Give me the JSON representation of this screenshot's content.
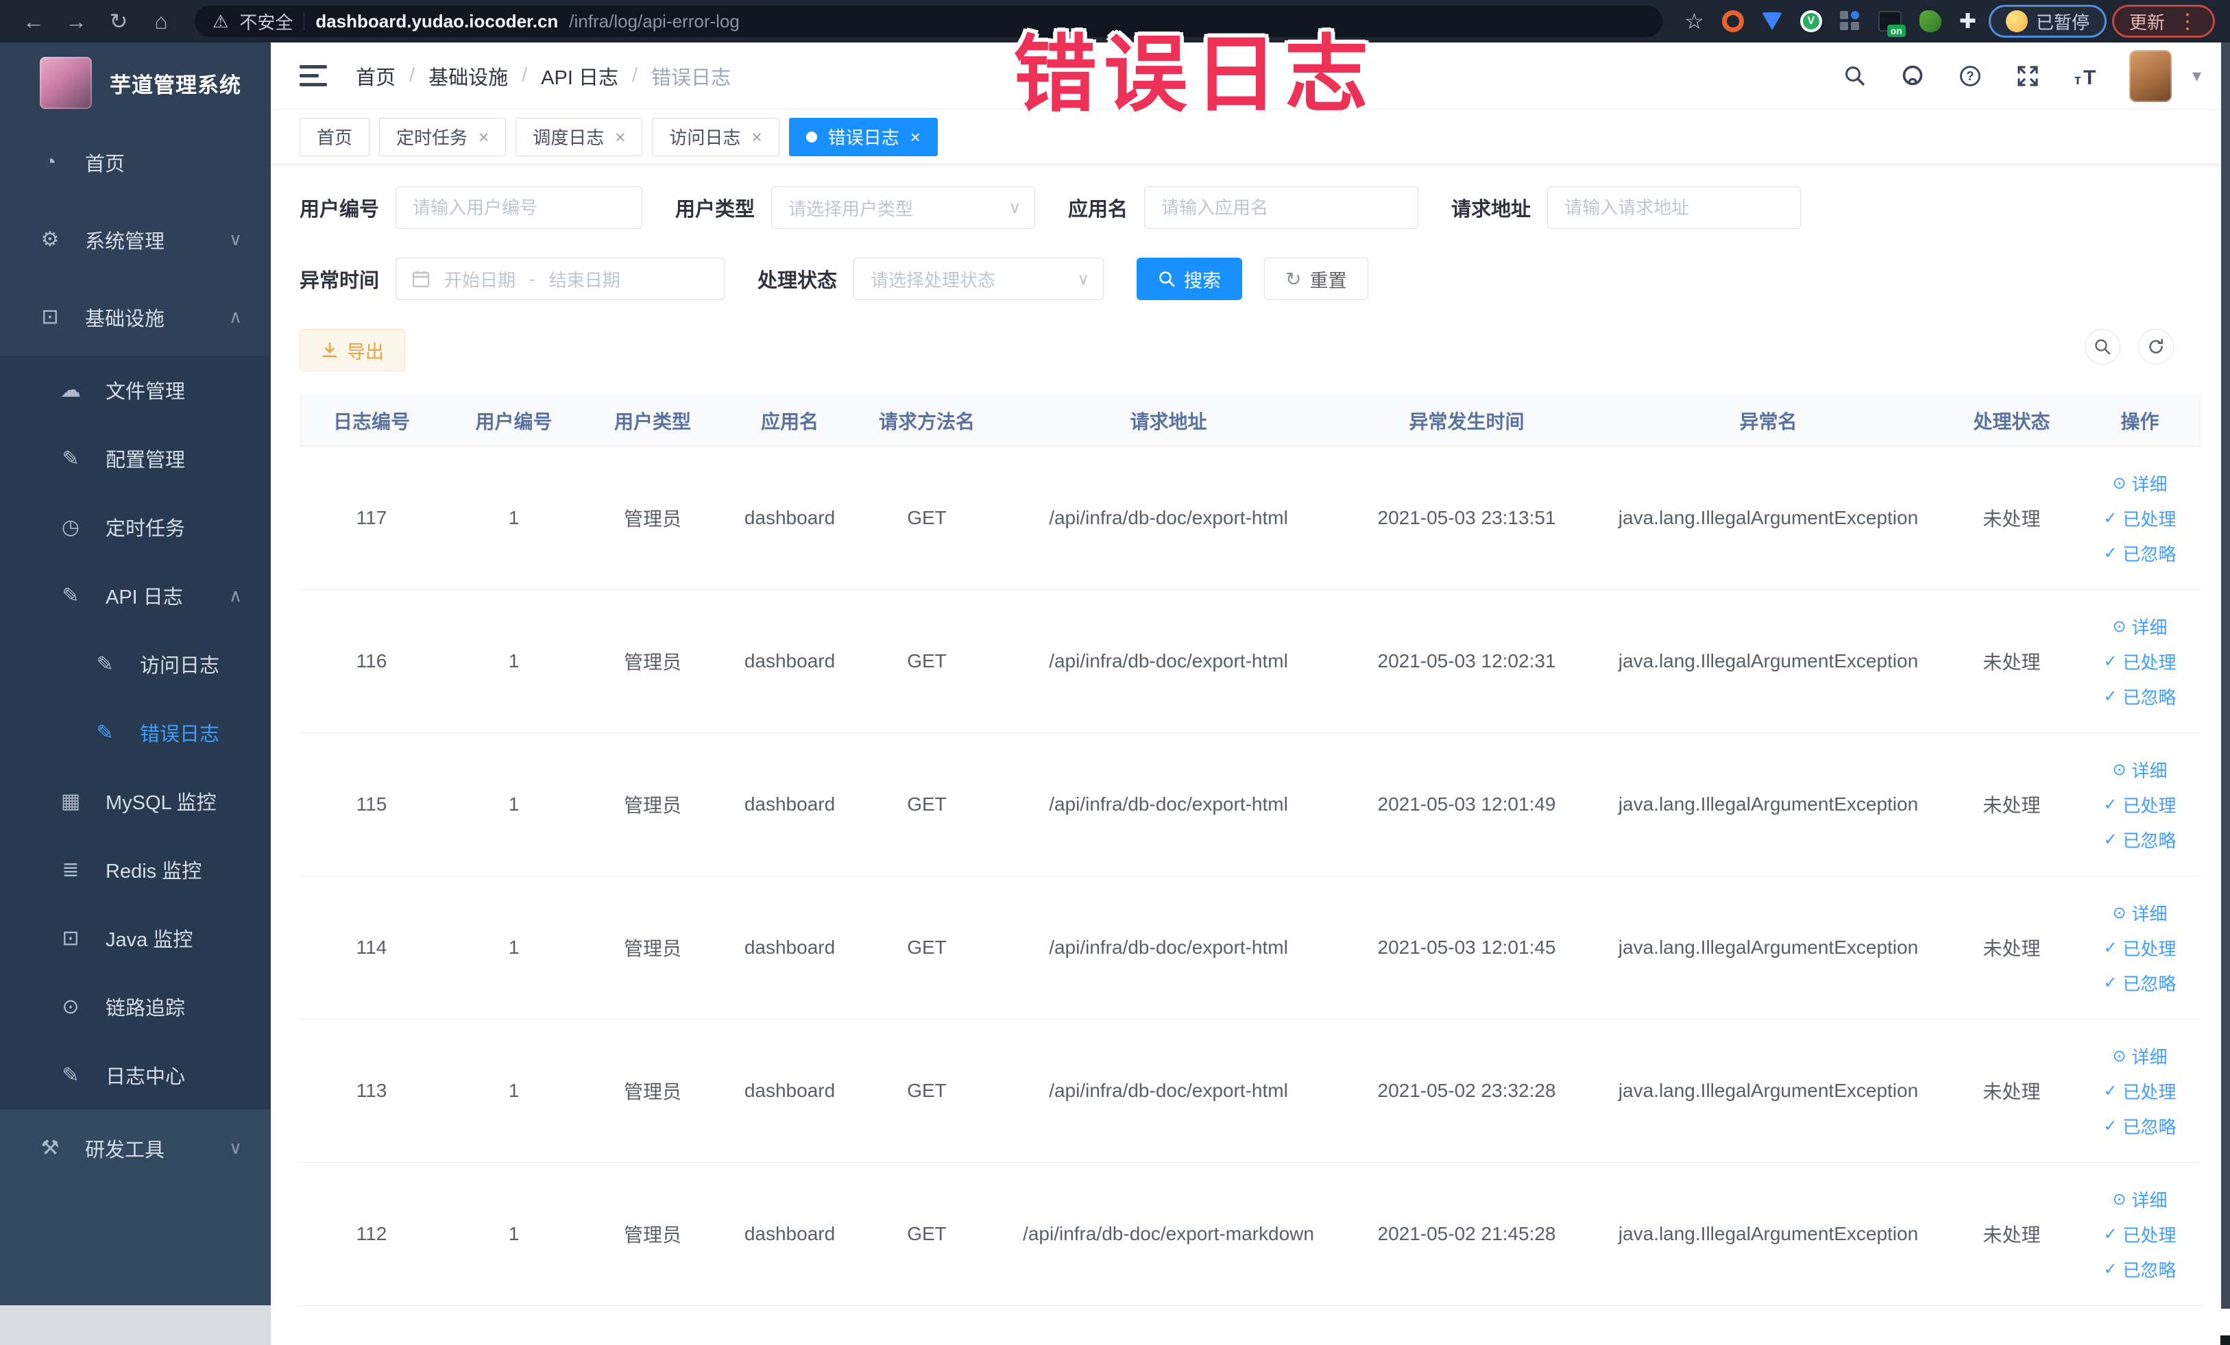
{
  "colors": {
    "accent": "#1890ff",
    "link": "#409eff",
    "warning_text": "#e6a23c",
    "overlay_pink": "#ee3157",
    "sidebar_bg": "#2e4156",
    "submenu_bg": "#273a4f"
  },
  "overlay_label": "错误日志",
  "browser": {
    "security_label": "不安全",
    "url_host": "dashboard.yudao.iocoder.cn",
    "url_path": "/infra/log/api-error-log",
    "paused_badge": "已暂停",
    "update_badge": "更新"
  },
  "sidebar": {
    "app_title": "芋道管理系统",
    "menu": [
      {
        "label": "首页",
        "icon": "dashboard-icon",
        "level": 0
      },
      {
        "label": "系统管理",
        "icon": "gear-icon",
        "level": 0,
        "chevron": "down"
      },
      {
        "label": "基础设施",
        "icon": "infra-icon",
        "level": 0,
        "chevron": "up"
      },
      {
        "label": "文件管理",
        "icon": "file-manage-icon",
        "level": 1
      },
      {
        "label": "配置管理",
        "icon": "config-manage-icon",
        "level": 1
      },
      {
        "label": "定时任务",
        "icon": "cron-job-icon",
        "level": 1
      },
      {
        "label": "API 日志",
        "icon": "api-log-icon",
        "level": 1,
        "chevron": "up"
      },
      {
        "label": "访问日志",
        "icon": "access-log-icon",
        "level": 2
      },
      {
        "label": "错误日志",
        "icon": "error-log-icon",
        "level": 2,
        "active": true
      },
      {
        "label": "MySQL 监控",
        "icon": "mysql-monitor-icon",
        "level": 1
      },
      {
        "label": "Redis 监控",
        "icon": "redis-monitor-icon",
        "level": 1
      },
      {
        "label": "Java 监控",
        "icon": "java-monitor-icon",
        "level": 1
      },
      {
        "label": "链路追踪",
        "icon": "trace-icon",
        "level": 1
      },
      {
        "label": "日志中心",
        "icon": "log-center-icon",
        "level": 1
      }
    ],
    "bottom_menu": [
      {
        "label": "研发工具",
        "icon": "devtools-icon",
        "level": 0,
        "chevron": "down"
      }
    ]
  },
  "header": {
    "breadcrumb": [
      "首页",
      "基础设施",
      "API 日志",
      "错误日志"
    ]
  },
  "tabs": [
    {
      "label": "首页",
      "closable": false,
      "active": false
    },
    {
      "label": "定时任务",
      "closable": true,
      "active": false
    },
    {
      "label": "调度日志",
      "closable": true,
      "active": false
    },
    {
      "label": "访问日志",
      "closable": true,
      "active": false
    },
    {
      "label": "错误日志",
      "closable": true,
      "active": true
    }
  ],
  "filters": {
    "user_id": {
      "label": "用户编号",
      "placeholder": "请输入用户编号",
      "value": ""
    },
    "user_type": {
      "label": "用户类型",
      "placeholder": "请选择用户类型"
    },
    "app_name": {
      "label": "应用名",
      "placeholder": "请输入应用名",
      "value": ""
    },
    "request_url": {
      "label": "请求地址",
      "placeholder": "请输入请求地址",
      "value": ""
    },
    "exception_time": {
      "label": "异常时间",
      "start_placeholder": "开始日期",
      "separator": "-",
      "end_placeholder": "结束日期"
    },
    "process_status": {
      "label": "处理状态",
      "placeholder": "请选择处理状态"
    },
    "search_label": "搜索",
    "reset_label": "重置"
  },
  "toolbar": {
    "export_label": "导出"
  },
  "table": {
    "columns": [
      "日志编号",
      "用户编号",
      "用户类型",
      "应用名",
      "请求方法名",
      "请求地址",
      "异常发生时间",
      "异常名",
      "处理状态",
      "操作"
    ],
    "actions": {
      "detail": "详细",
      "processed": "已处理",
      "ignored": "已忽略"
    },
    "rows": [
      {
        "id": "117",
        "user_id": "1",
        "user_type": "管理员",
        "app": "dashboard",
        "method": "GET",
        "url": "/api/infra/db-doc/export-html",
        "time": "2021-05-03 23:13:51",
        "exception": "java.lang.IllegalArgumentException",
        "status": "未处理"
      },
      {
        "id": "116",
        "user_id": "1",
        "user_type": "管理员",
        "app": "dashboard",
        "method": "GET",
        "url": "/api/infra/db-doc/export-html",
        "time": "2021-05-03 12:02:31",
        "exception": "java.lang.IllegalArgumentException",
        "status": "未处理"
      },
      {
        "id": "115",
        "user_id": "1",
        "user_type": "管理员",
        "app": "dashboard",
        "method": "GET",
        "url": "/api/infra/db-doc/export-html",
        "time": "2021-05-03 12:01:49",
        "exception": "java.lang.IllegalArgumentException",
        "status": "未处理"
      },
      {
        "id": "114",
        "user_id": "1",
        "user_type": "管理员",
        "app": "dashboard",
        "method": "GET",
        "url": "/api/infra/db-doc/export-html",
        "time": "2021-05-03 12:01:45",
        "exception": "java.lang.IllegalArgumentException",
        "status": "未处理"
      },
      {
        "id": "113",
        "user_id": "1",
        "user_type": "管理员",
        "app": "dashboard",
        "method": "GET",
        "url": "/api/infra/db-doc/export-html",
        "time": "2021-05-02 23:32:28",
        "exception": "java.lang.IllegalArgumentException",
        "status": "未处理"
      },
      {
        "id": "112",
        "user_id": "1",
        "user_type": "管理员",
        "app": "dashboard",
        "method": "GET",
        "url": "/api/infra/db-doc/export-markdown",
        "time": "2021-05-02 21:45:28",
        "exception": "java.lang.IllegalArgumentException",
        "status": "未处理"
      }
    ]
  }
}
